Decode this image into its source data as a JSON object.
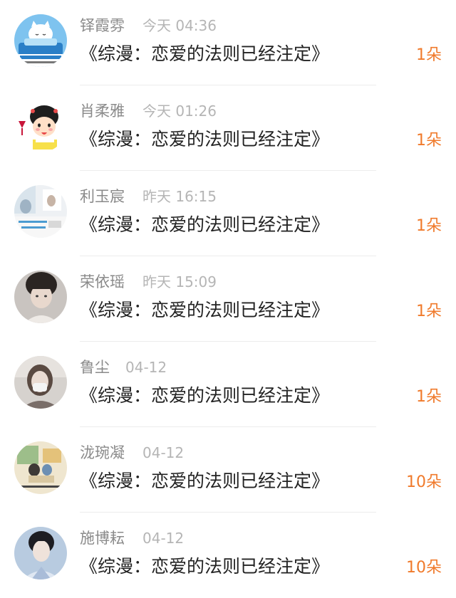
{
  "entries": [
    {
      "name": "铎霞雰",
      "time": "今天 04:36",
      "title": "《综漫：恋爱的法则已经注定》",
      "count": "1朵",
      "avatar_icon": "cat-sleeping-avatar"
    },
    {
      "name": "肖柔雅",
      "time": "今天 01:26",
      "title": "《综漫：恋爱的法则已经注定》",
      "count": "1朵",
      "avatar_icon": "cartoon-girl-avatar"
    },
    {
      "name": "利玉宸",
      "time": "昨天 16:15",
      "title": "《综漫：恋爱的法则已经注定》",
      "count": "1朵",
      "avatar_icon": "photo-avatar"
    },
    {
      "name": "荣依瑶",
      "time": "昨天 15:09",
      "title": "《综漫：恋爱的法则已经注定》",
      "count": "1朵",
      "avatar_icon": "person-photo-avatar"
    },
    {
      "name": "鲁尘",
      "time": "04-12",
      "title": "《综漫：恋爱的法则已经注定》",
      "count": "1朵",
      "avatar_icon": "person-photo-avatar"
    },
    {
      "name": "泷琬凝",
      "time": "04-12",
      "title": "《综漫：恋爱的法则已经注定》",
      "count": "10朵",
      "avatar_icon": "painting-avatar"
    },
    {
      "name": "施博耘",
      "time": "04-12",
      "title": "《综漫：恋爱的法则已经注定》",
      "count": "10朵",
      "avatar_icon": "person-photo-avatar"
    }
  ],
  "colors": {
    "name": "#8a8a8a",
    "time": "#b5b5b5",
    "title": "#222222",
    "count_accent": "#f07a2b",
    "divider": "#ececec"
  }
}
